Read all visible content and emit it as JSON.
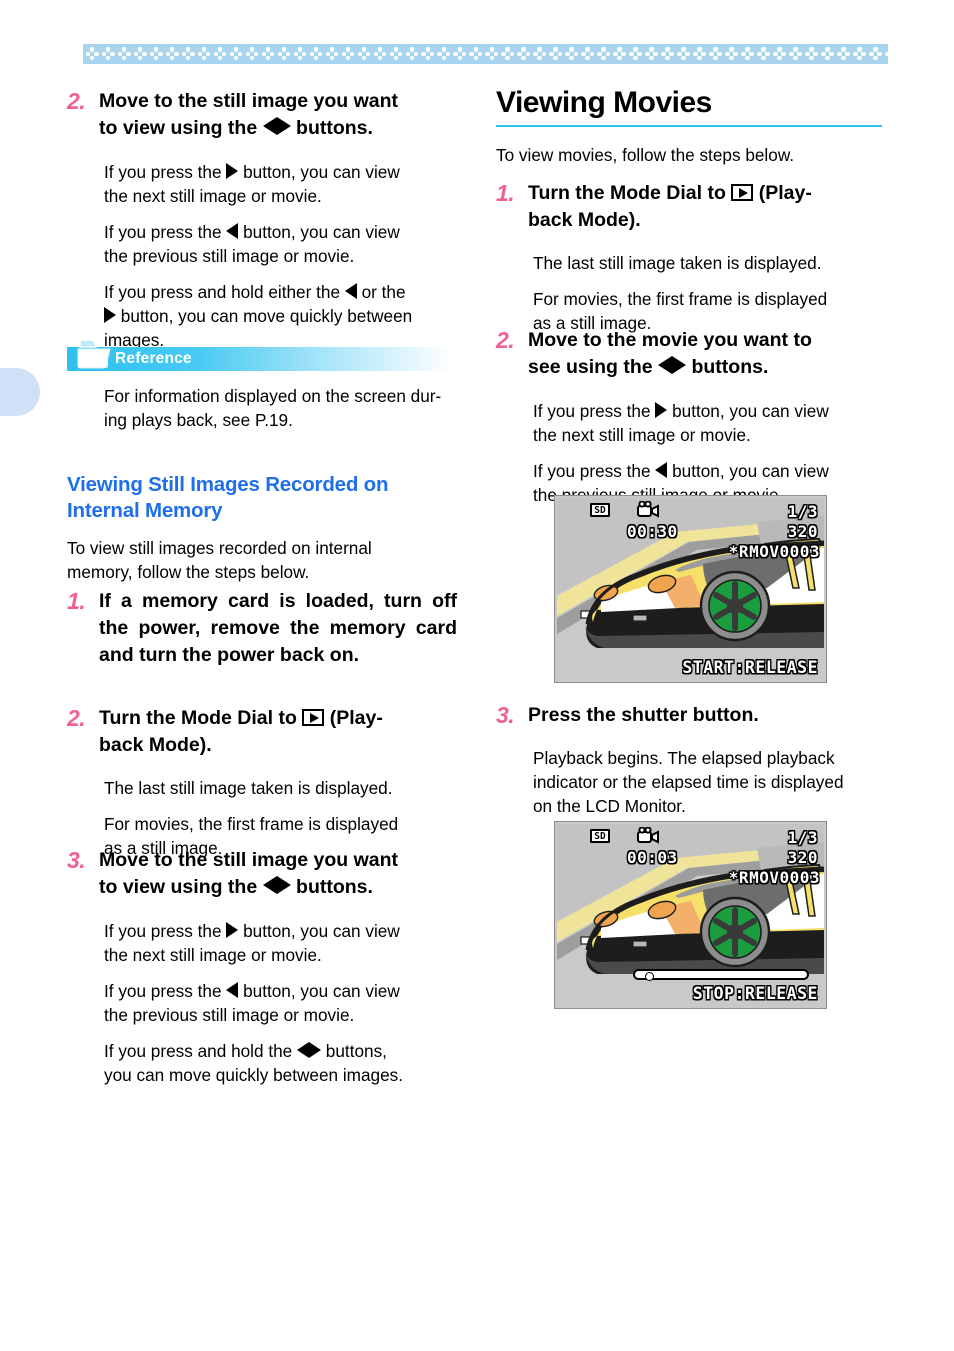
{
  "decor": {
    "band_motif_count": 52,
    "band_color": "#a9d4ef",
    "accent_pink": "#f4608c",
    "accent_blue": "#1f6feb",
    "accent_cyan": "#29c5ef",
    "side_tab_color": "#cfe0f7"
  },
  "left_column": {
    "step2": {
      "number": "2.",
      "title_a": "Move to the still image you want",
      "title_b": "to view using the",
      "title_c": "buttons.",
      "paras": [
        {
          "a": "If you press the",
          "b": "button, you can view",
          "c": "the next still image or movie.",
          "arrow": "right"
        },
        {
          "a": "If you press the",
          "b": "button, you can view",
          "c": "the previous still image or movie.",
          "arrow": "left"
        }
      ],
      "para3_a": "If you press and hold either the",
      "para3_or": "or the",
      "para3_b": "button, you can move quickly between",
      "para3_c": "images."
    },
    "reference": {
      "label": "Reference",
      "icon": "folder-icon",
      "text_a": "For information displayed on the screen dur-",
      "text_b": "ing plays back, see P.19."
    },
    "section": {
      "heading_a": "Viewing Still Images Recorded on",
      "heading_b": "Internal Memory",
      "intro_a": "To view  still images recorded on internal",
      "intro_b": "memory, follow the steps below."
    },
    "step1": {
      "number": "1.",
      "title": "If a memory card is loaded, turn off the power, remove the memory card and turn the power back on."
    },
    "step2b": {
      "number": "2.",
      "title_a": "Turn the Mode Dial to",
      "title_b": "(Play-",
      "title_c": "back Mode).",
      "body_a": "The last still image taken is displayed.",
      "body_b": "For movies, the first frame is displayed",
      "body_c": "as a still image."
    },
    "step3": {
      "number": "3.",
      "title_a": "Move to the still image you want",
      "title_b": "to view using the",
      "title_c": "buttons.",
      "p1_a": "If you press the",
      "p1_b": "button, you can view",
      "p1_c": "the next still image or movie.",
      "p2_a": "If you press the",
      "p2_b": "button, you can view",
      "p2_c": "the previous still image or movie.",
      "p3_a": "If you press and hold the",
      "p3_b": "buttons,",
      "p3_c": "you can move quickly between images."
    }
  },
  "right_column": {
    "heading": "Viewing Movies",
    "intro": "To view movies, follow the steps below.",
    "step1": {
      "number": "1.",
      "title_a": "Turn  the  Mode  Dial  to",
      "title_b": "(Play-",
      "title_c": "back Mode).",
      "body_a": "The last still image taken is displayed.",
      "body_b": "For movies, the first frame is displayed",
      "body_c": "as a still image."
    },
    "step2": {
      "number": "2.",
      "title_a": "Move to the movie you want to",
      "title_b": "see using the",
      "title_c": "buttons.",
      "p1_a": "If you press the",
      "p1_b": "button, you can view",
      "p1_c": "the next still image or movie.",
      "p2_a": "If you press the",
      "p2_b": "button, you can view",
      "p2_c": "the previous still image or movie."
    },
    "step3": {
      "number": "3.",
      "title": "Press the shutter button.",
      "body_a": "Playback begins. The elapsed playback",
      "body_b": "indicator or the elapsed time is displayed",
      "body_c": "on the LCD Monitor."
    }
  },
  "lcd_screens": [
    {
      "name": "movie-first-frame",
      "sd_badge": "SD",
      "movie_icon": "movie-camera-icon",
      "frame_counter": "1/3",
      "resolution": "320",
      "filename": "*RMOV0003",
      "time": "00:30",
      "bottom_hint": "START:RELEASE",
      "progress_visible": false
    },
    {
      "name": "movie-playing",
      "sd_badge": "SD",
      "movie_icon": "movie-camera-icon",
      "frame_counter": "1/3",
      "resolution": "320",
      "filename": "*RMOV0003",
      "time": "00:03",
      "bottom_hint": "STOP:RELEASE",
      "progress_visible": true,
      "progress_percent": 4
    }
  ]
}
